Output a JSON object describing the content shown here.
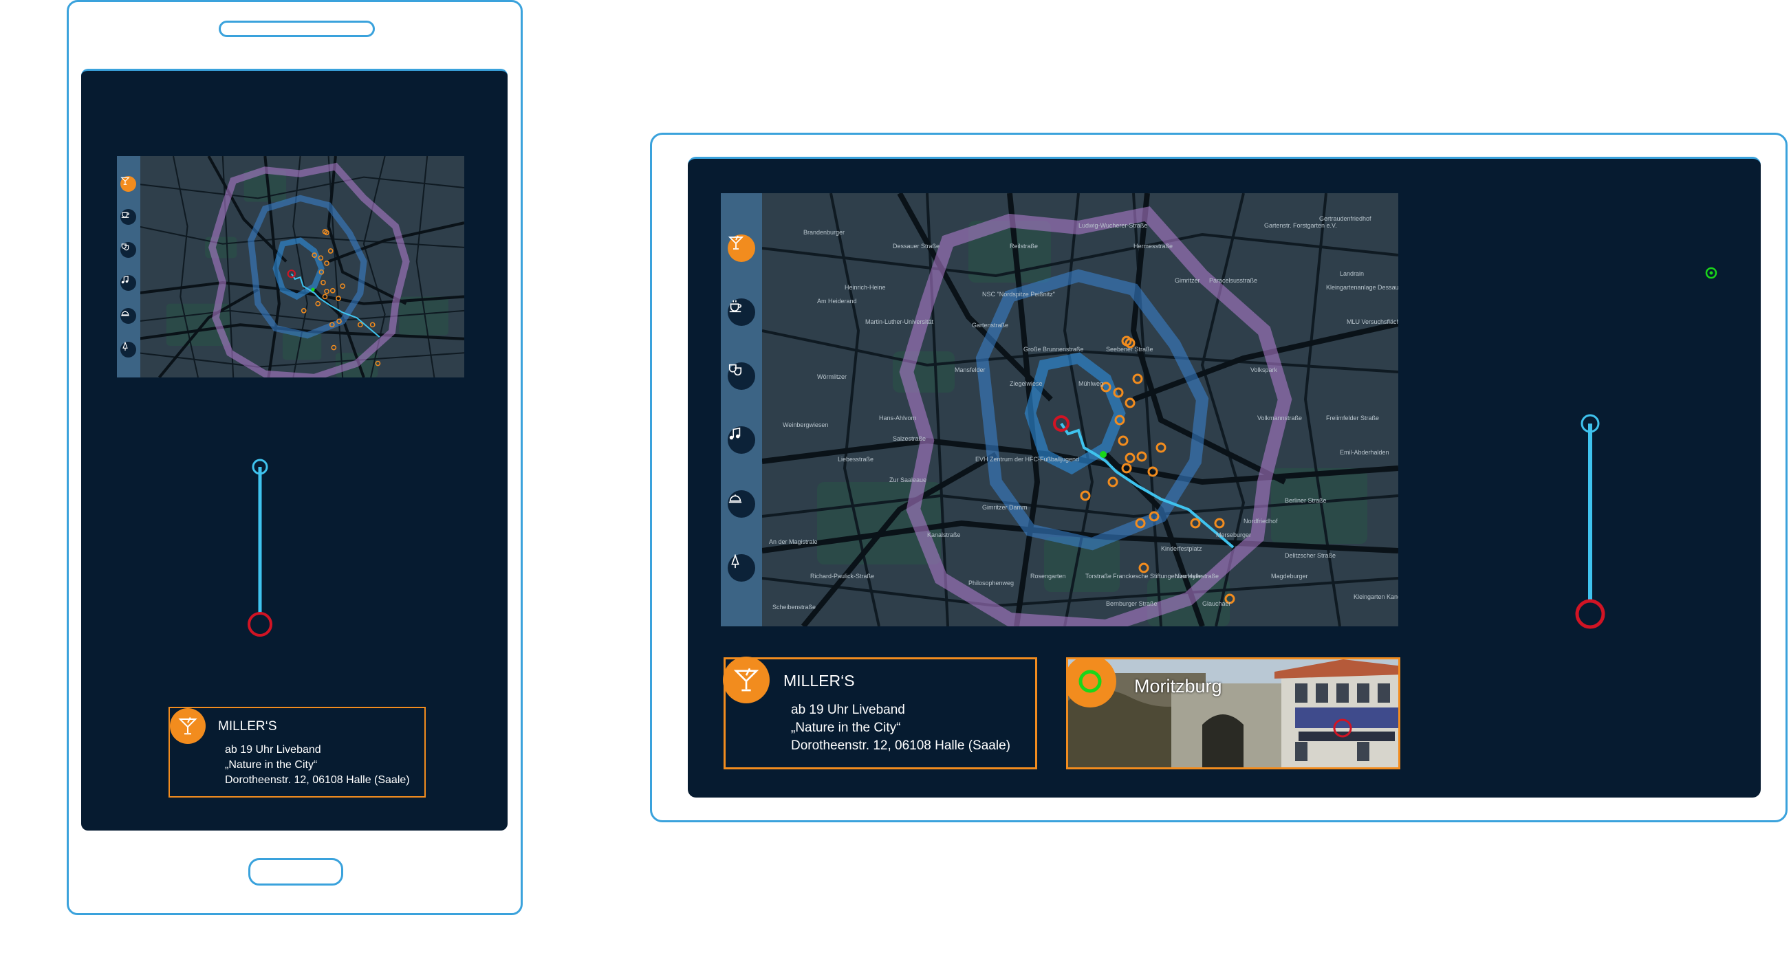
{
  "venue": {
    "name": "MILLER‘S",
    "lines": [
      "ab 19 Uhr Liveband",
      "„Nature in the City“",
      "Dorotheenstr. 12, 06108 Halle (Saale)"
    ]
  },
  "poi": {
    "name": "Moritzburg"
  },
  "categories": [
    "cocktail-icon",
    "coffee-cup-icon",
    "theater-masks-icon",
    "music-note-icon",
    "food-cloche-icon",
    "tree-icon"
  ],
  "map_labels": [
    "Brandenburger",
    "Am Heiderand",
    "Martin-Luther-Universität",
    "Heinrich-Heine",
    "NSC \"Nordspitze Peißnitz\"",
    "Große Brunnenstraße",
    "Gartenstraße",
    "Mühlweg",
    "Weinbergwiesen",
    "Wörmlitzer",
    "Ziegelwiese",
    "Salzestraße",
    "Zur Saaleaue",
    "EVH Zentrum der HFC-Fußballjugend",
    "Liebesstraße",
    "An der Magistrale",
    "Richard-Paulick-Straße",
    "Scheibenstraße",
    "Philosophenweg",
    "Torstraße",
    "Franckesche Stiftungen zu Halle",
    "Delitzscher Straße",
    "Berliner Straße",
    "Nordfriedhof",
    "Gartenstr. Forstgarten e.V.",
    "Gertraudenfriedhof",
    "Landrain",
    "Kleingartenanlage Dessauer Straße e.V.",
    "MLU Versuchsflächen der Landwirtschaftlichen Fakultät",
    "Kleingarten Kanenaer Weg",
    "Paracelsusstraße",
    "Freiimfelder Straße",
    "Volkmannstraße",
    "Emil-Abderhalden",
    "Reilstraße",
    "Seebener Straße",
    "Gimritzer",
    "Ludwig-Wucherer-Straße",
    "Hermesstraße",
    "Niemeyerstraße",
    "Merseburger",
    "Magdeburger",
    "Hans-Ahlvorn",
    "Mansfelder",
    "Kinderfestplatz",
    "Kanalstraße",
    "Gimritzer Damm",
    "Rosengarten",
    "Bernburger Straße",
    "Glauchaer",
    "Volkspark",
    "Dessauer Straße"
  ],
  "colors": {
    "screen": "#061b30",
    "device_outline": "#3aa2dc",
    "accent_orange": "#f28c1e",
    "route_blue": "#3fc3ee",
    "start_marker_red": "#d11424",
    "position_green": "#1ad61a",
    "zone_purple": "#b67fd6",
    "zone_blue": "#3a85d6"
  }
}
